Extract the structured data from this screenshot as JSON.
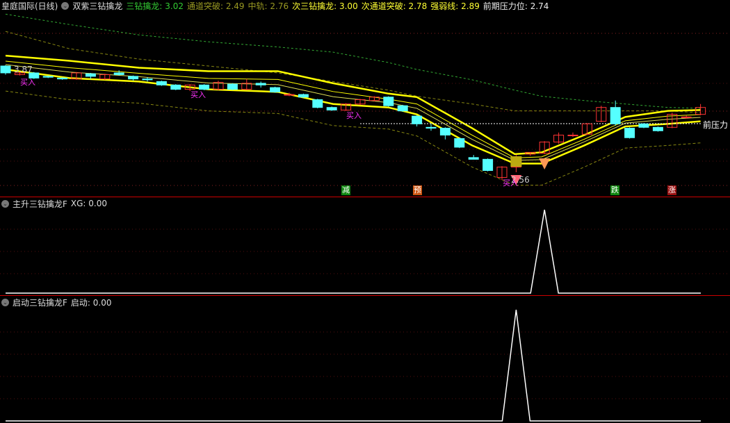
{
  "header": {
    "stock": "皇庭国际(日线)",
    "indicator": "双紫三钻擒龙",
    "values": [
      {
        "label": "三钻擒龙",
        "value": "3.02",
        "color": "#33cc33"
      },
      {
        "label": "通道突破",
        "value": "2.49",
        "color": "#999922"
      },
      {
        "label": "中轨",
        "value": "2.76",
        "color": "#999922"
      },
      {
        "label": "次三钻擒龙",
        "value": "3.00",
        "color": "#ffff33"
      },
      {
        "label": "次通道突破",
        "value": "2.78",
        "color": "#ffff33"
      },
      {
        "label": "强弱线",
        "value": "2.89",
        "color": "#ffff33"
      },
      {
        "label": "前期压力位",
        "value": "2.74",
        "color": "#eeeeee"
      }
    ]
  },
  "main": {
    "high_label": "3.87",
    "low_label": "2.56",
    "pressure_label": "前压力",
    "buy_label": "买入",
    "signals": [
      {
        "text": "减",
        "color": "#118811"
      },
      {
        "text": "预",
        "color": "#cc5511"
      },
      {
        "text": "跌",
        "color": "#118811"
      },
      {
        "text": "涨",
        "color": "#991111"
      }
    ],
    "colors": {
      "up": "#ff3333",
      "down": "#55ffff",
      "band": "#ffff00",
      "dash1": "#33aa33",
      "dash2": "#888811"
    }
  },
  "panel2": {
    "title": "主升三钻擒龙F",
    "value_label": "XG: 0.00"
  },
  "panel3": {
    "title": "启动三钻擒龙F",
    "value_label": "启动: 0.00"
  },
  "chart_data": {
    "type": "candlestick",
    "candles": [
      [
        3.87,
        3.79,
        3.88,
        3.77
      ],
      [
        3.77,
        3.79,
        3.8,
        3.76
      ],
      [
        3.79,
        3.73,
        3.8,
        3.72
      ],
      [
        3.75,
        3.74,
        3.76,
        3.73
      ],
      [
        3.73,
        3.72,
        3.74,
        3.71
      ],
      [
        3.72,
        3.79,
        3.8,
        3.71
      ],
      [
        3.78,
        3.75,
        3.79,
        3.72
      ],
      [
        3.72,
        3.77,
        3.78,
        3.71
      ],
      [
        3.79,
        3.77,
        3.82,
        3.76
      ],
      [
        3.75,
        3.72,
        3.76,
        3.7
      ],
      [
        3.72,
        3.71,
        3.74,
        3.69
      ],
      [
        3.69,
        3.65,
        3.7,
        3.64
      ],
      [
        3.65,
        3.6,
        3.66,
        3.59
      ],
      [
        3.6,
        3.65,
        3.66,
        3.58
      ],
      [
        3.65,
        3.6,
        3.66,
        3.59
      ],
      [
        3.6,
        3.68,
        3.7,
        3.59
      ],
      [
        3.66,
        3.6,
        3.67,
        3.59
      ],
      [
        3.6,
        3.67,
        3.72,
        3.59
      ],
      [
        3.67,
        3.65,
        3.69,
        3.62
      ],
      [
        3.62,
        3.57,
        3.63,
        3.56
      ],
      [
        3.54,
        3.54,
        3.56,
        3.52
      ],
      [
        3.54,
        3.51,
        3.55,
        3.5
      ],
      [
        3.48,
        3.39,
        3.49,
        3.38
      ],
      [
        3.39,
        3.36,
        3.4,
        3.35
      ],
      [
        3.36,
        3.43,
        3.44,
        3.35
      ],
      [
        3.43,
        3.48,
        3.49,
        3.42
      ],
      [
        3.47,
        3.51,
        3.52,
        3.46
      ],
      [
        3.51,
        3.41,
        3.52,
        3.4
      ],
      [
        3.41,
        3.35,
        3.42,
        3.34
      ],
      [
        3.29,
        3.2,
        3.3,
        3.17
      ],
      [
        3.16,
        3.15,
        3.2,
        3.12
      ],
      [
        3.15,
        3.07,
        3.16,
        3.02
      ],
      [
        3.03,
        2.93,
        3.04,
        2.92
      ],
      [
        2.81,
        2.79,
        2.84,
        2.79
      ],
      [
        2.79,
        2.66,
        2.8,
        2.65
      ],
      [
        2.58,
        2.7,
        2.71,
        2.55
      ],
      [
        2.7,
        2.82,
        2.84,
        2.64
      ],
      [
        2.85,
        2.87,
        2.87,
        2.83
      ],
      [
        2.86,
        2.99,
        3.0,
        2.85
      ],
      [
        2.99,
        3.07,
        3.1,
        2.97
      ],
      [
        3.07,
        3.07,
        3.1,
        3.05
      ],
      [
        3.08,
        3.2,
        3.21,
        3.07
      ],
      [
        3.23,
        3.39,
        3.41,
        3.22
      ],
      [
        3.39,
        3.2,
        3.47,
        3.18
      ],
      [
        3.15,
        3.04,
        3.16,
        3.03
      ],
      [
        3.2,
        3.16,
        3.21,
        3.15
      ],
      [
        3.16,
        3.12,
        3.17,
        3.11
      ],
      [
        3.16,
        3.31,
        3.33,
        3.15
      ],
      [
        3.28,
        3.28,
        3.3,
        3.26
      ],
      [
        3.31,
        3.39,
        3.43,
        3.3
      ]
    ],
    "line_x": [
      0,
      4.5,
      9.4,
      14.3,
      19.2,
      23.1,
      27,
      29,
      32.9,
      35.9,
      37.8,
      40.8,
      43.7,
      46.7,
      49
    ],
    "upper_band": [
      3.99,
      3.93,
      3.85,
      3.81,
      3.81,
      3.67,
      3.55,
      3.51,
      3.15,
      2.85,
      2.87,
      3.07,
      3.28,
      3.35,
      3.36
    ],
    "lower_band": [
      3.83,
      3.73,
      3.69,
      3.6,
      3.57,
      3.43,
      3.39,
      3.31,
      2.95,
      2.74,
      2.74,
      2.95,
      3.17,
      3.2,
      3.23
    ],
    "dashed_upper": [
      4.47,
      4.35,
      4.23,
      4.15,
      4.09,
      4.03,
      3.91,
      3.83,
      3.71,
      3.59,
      3.52,
      3.47,
      3.43,
      3.39,
      3.38
    ],
    "dashed_mid": [
      4.27,
      4.07,
      3.95,
      3.87,
      3.79,
      3.69,
      3.59,
      3.52,
      3.43,
      3.35,
      3.35,
      3.35,
      3.35,
      3.35,
      3.33
    ],
    "pressure_level": 2.74,
    "buy_points": [
      1,
      13,
      24,
      35
    ],
    "signal_points": [
      23,
      29,
      42,
      47
    ],
    "xg_spikes": [
      38
    ],
    "qidong_spikes": [
      36
    ]
  }
}
